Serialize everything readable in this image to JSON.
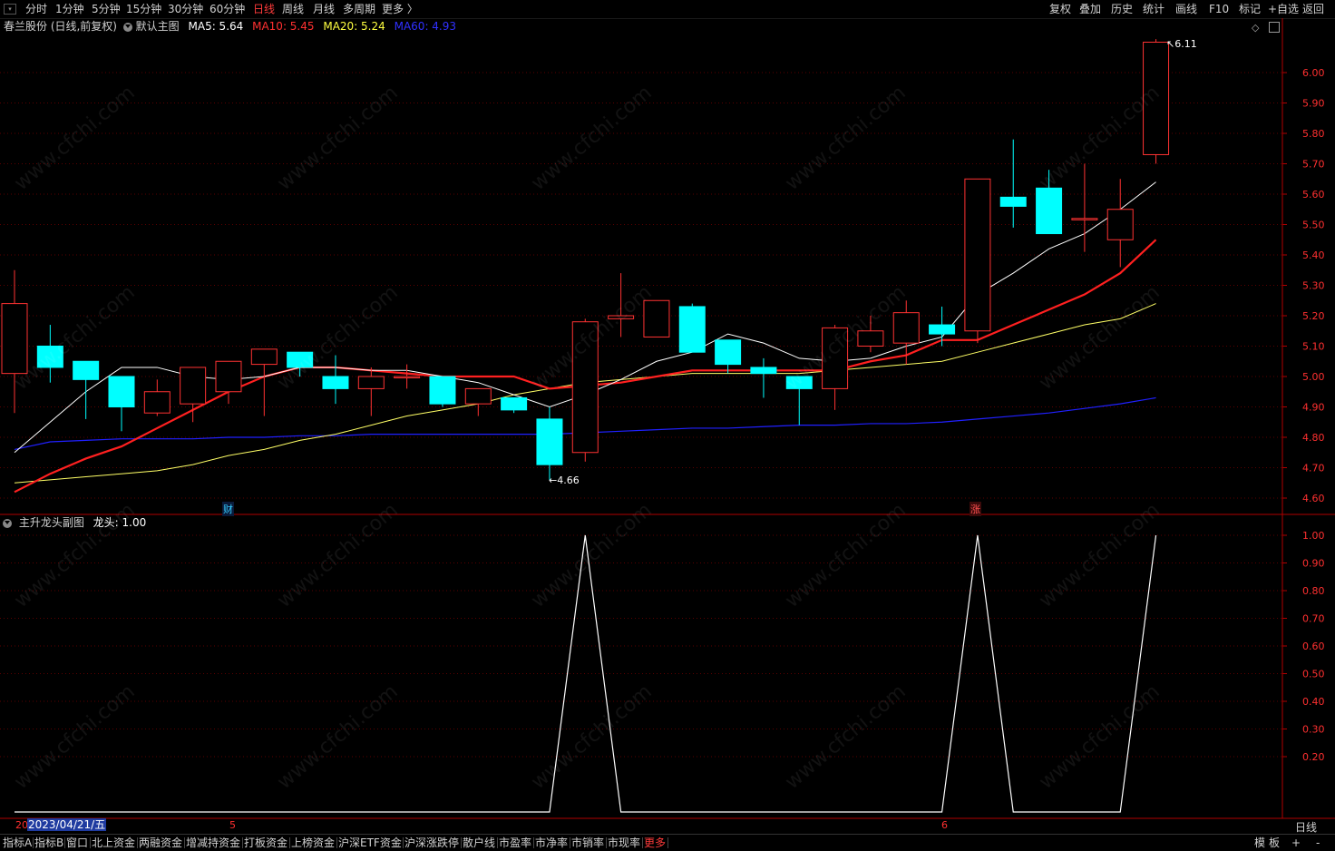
{
  "topbar": {
    "periods": [
      "分时",
      "1分钟",
      "5分钟",
      "15分钟",
      "30分钟",
      "60分钟",
      "日线",
      "周线",
      "月线",
      "多周期",
      "更多 〉"
    ],
    "active_period": "日线",
    "right_buttons": [
      "复权",
      "叠加",
      "历史",
      "统计",
      "画线",
      "F10",
      "标记",
      "+自选",
      "返回"
    ]
  },
  "main_header": {
    "stock": "春兰股份 (日线,前复权)",
    "indicator": "默认主图",
    "ma5": "MA5: 5.64",
    "ma10": "MA10: 5.45",
    "ma20": "MA20: 5.24",
    "ma60": "MA60: 4.93"
  },
  "sub_header": {
    "indicator": "主升龙头副图",
    "value": "龙头: 1.00"
  },
  "markers": {
    "high_label": "6.11",
    "low_label": "4.66",
    "cai": "财",
    "zhang": "涨"
  },
  "x_axis": {
    "label_left": "20",
    "date": "2023/04/21/五",
    "month5": "5",
    "month6": "6",
    "period": "日线"
  },
  "bottom_tabs": [
    "指标A",
    "指标B",
    "窗口",
    "北上资金",
    "两融资金",
    "增减持资金",
    "打板资金",
    "上榜资金",
    "沪深ETF资金",
    "沪深涨跌停",
    "散户线",
    "市盈率",
    "市净率",
    "市销率",
    "市现率",
    "更多"
  ],
  "bottom_right": [
    "模",
    "板",
    "+",
    "-"
  ],
  "watermark": "www.cfchi.com",
  "colors": {
    "up": "#ff3232",
    "down": "#00ffff",
    "ma5": "#ffffff",
    "ma10": "#ff2020",
    "ma20": "#ffff66",
    "ma60": "#2020ff",
    "grid": "#8b0000"
  },
  "chart_data": [
    {
      "type": "candlestick",
      "title": "春兰股份 (日线,前复权)",
      "ylim": [
        4.55,
        6.15
      ],
      "y_ticks": [
        4.6,
        4.7,
        4.8,
        4.9,
        5.0,
        5.1,
        5.2,
        5.3,
        5.4,
        5.5,
        5.6,
        5.7,
        5.8,
        5.9,
        6.0
      ],
      "candles": [
        {
          "o": 5.01,
          "h": 5.35,
          "l": 4.88,
          "c": 5.24
        },
        {
          "o": 5.1,
          "h": 5.17,
          "l": 4.98,
          "c": 5.03
        },
        {
          "o": 5.05,
          "h": 5.05,
          "l": 4.86,
          "c": 4.99
        },
        {
          "o": 5.0,
          "h": 5.0,
          "l": 4.82,
          "c": 4.9
        },
        {
          "o": 4.88,
          "h": 4.99,
          "l": 4.87,
          "c": 4.95
        },
        {
          "o": 4.91,
          "h": 5.03,
          "l": 4.85,
          "c": 5.03
        },
        {
          "o": 4.95,
          "h": 5.05,
          "l": 4.91,
          "c": 5.05
        },
        {
          "o": 5.04,
          "h": 5.09,
          "l": 4.87,
          "c": 5.09
        },
        {
          "o": 5.08,
          "h": 5.08,
          "l": 5.0,
          "c": 5.03
        },
        {
          "o": 5.0,
          "h": 5.07,
          "l": 4.91,
          "c": 4.96
        },
        {
          "o": 4.96,
          "h": 5.03,
          "l": 4.87,
          "c": 5.0
        },
        {
          "o": 5.0,
          "h": 5.04,
          "l": 4.96,
          "c": 5.0
        },
        {
          "o": 5.0,
          "h": 5.0,
          "l": 4.9,
          "c": 4.91
        },
        {
          "o": 4.91,
          "h": 4.96,
          "l": 4.87,
          "c": 4.96
        },
        {
          "o": 4.93,
          "h": 4.93,
          "l": 4.88,
          "c": 4.89
        },
        {
          "o": 4.86,
          "h": 4.9,
          "l": 4.66,
          "c": 4.71
        },
        {
          "o": 4.75,
          "h": 5.19,
          "l": 4.72,
          "c": 5.18
        },
        {
          "o": 5.19,
          "h": 5.34,
          "l": 5.13,
          "c": 5.2
        },
        {
          "o": 5.13,
          "h": 5.25,
          "l": 5.13,
          "c": 5.25
        },
        {
          "o": 5.23,
          "h": 5.24,
          "l": 5.08,
          "c": 5.08
        },
        {
          "o": 5.12,
          "h": 5.12,
          "l": 5.01,
          "c": 5.04
        },
        {
          "o": 5.03,
          "h": 5.06,
          "l": 4.93,
          "c": 5.01
        },
        {
          "o": 5.0,
          "h": 5.0,
          "l": 4.84,
          "c": 4.96
        },
        {
          "o": 4.96,
          "h": 5.17,
          "l": 4.89,
          "c": 5.16
        },
        {
          "o": 5.1,
          "h": 5.2,
          "l": 5.08,
          "c": 5.15
        },
        {
          "o": 5.11,
          "h": 5.25,
          "l": 5.04,
          "c": 5.21
        },
        {
          "o": 5.17,
          "h": 5.23,
          "l": 5.1,
          "c": 5.14
        },
        {
          "o": 5.15,
          "h": 5.65,
          "l": 5.11,
          "c": 5.65
        },
        {
          "o": 5.59,
          "h": 5.78,
          "l": 5.49,
          "c": 5.56
        },
        {
          "o": 5.62,
          "h": 5.68,
          "l": 5.47,
          "c": 5.47
        },
        {
          "o": 5.52,
          "h": 5.7,
          "l": 5.41,
          "c": 5.52
        },
        {
          "o": 5.45,
          "h": 5.65,
          "l": 5.36,
          "c": 5.55
        },
        {
          "o": 5.73,
          "h": 6.11,
          "l": 5.7,
          "c": 6.1
        }
      ],
      "ma5": [
        4.75,
        4.85,
        4.95,
        5.03,
        5.03,
        5.0,
        4.99,
        5.0,
        5.03,
        5.03,
        5.02,
        5.02,
        5.0,
        4.98,
        4.94,
        4.9,
        4.94,
        4.99,
        5.05,
        5.08,
        5.14,
        5.11,
        5.06,
        5.05,
        5.06,
        5.1,
        5.13,
        5.27,
        5.34,
        5.42,
        5.47,
        5.55,
        5.64
      ],
      "ma10": [
        4.62,
        4.68,
        4.73,
        4.77,
        4.83,
        4.89,
        4.95,
        5.0,
        5.03,
        5.03,
        5.02,
        5.01,
        5.0,
        5.0,
        5.0,
        4.96,
        4.97,
        4.98,
        5.0,
        5.02,
        5.02,
        5.02,
        5.02,
        5.02,
        5.05,
        5.07,
        5.12,
        5.12,
        5.17,
        5.22,
        5.27,
        5.34,
        5.45
      ],
      "ma20": [
        4.65,
        4.66,
        4.67,
        4.68,
        4.69,
        4.71,
        4.74,
        4.76,
        4.79,
        4.81,
        4.84,
        4.87,
        4.89,
        4.91,
        4.94,
        4.96,
        4.98,
        4.99,
        5.0,
        5.01,
        5.01,
        5.01,
        5.01,
        5.02,
        5.03,
        5.04,
        5.05,
        5.08,
        5.11,
        5.14,
        5.17,
        5.19,
        5.24
      ],
      "ma60": [
        4.76,
        4.785,
        4.79,
        4.795,
        4.795,
        4.795,
        4.8,
        4.8,
        4.805,
        4.805,
        4.81,
        4.81,
        4.81,
        4.81,
        4.81,
        4.81,
        4.815,
        4.82,
        4.825,
        4.83,
        4.83,
        4.835,
        4.84,
        4.84,
        4.845,
        4.845,
        4.85,
        4.86,
        4.87,
        4.88,
        4.895,
        4.91,
        4.93
      ]
    },
    {
      "type": "line",
      "title": "主升龙头副图",
      "series": [
        {
          "name": "龙头",
          "values": [
            0,
            0,
            0,
            0,
            0,
            0,
            0,
            0,
            0,
            0,
            0,
            0,
            0,
            0,
            0,
            0,
            1,
            0,
            0,
            0,
            0,
            0,
            0,
            0,
            0,
            0,
            0,
            1,
            0,
            0,
            0,
            0,
            1
          ]
        }
      ],
      "ylim": [
        0,
        1.05
      ],
      "y_ticks": [
        0.2,
        0.3,
        0.4,
        0.5,
        0.6,
        0.7,
        0.8,
        0.9,
        1.0
      ]
    }
  ]
}
